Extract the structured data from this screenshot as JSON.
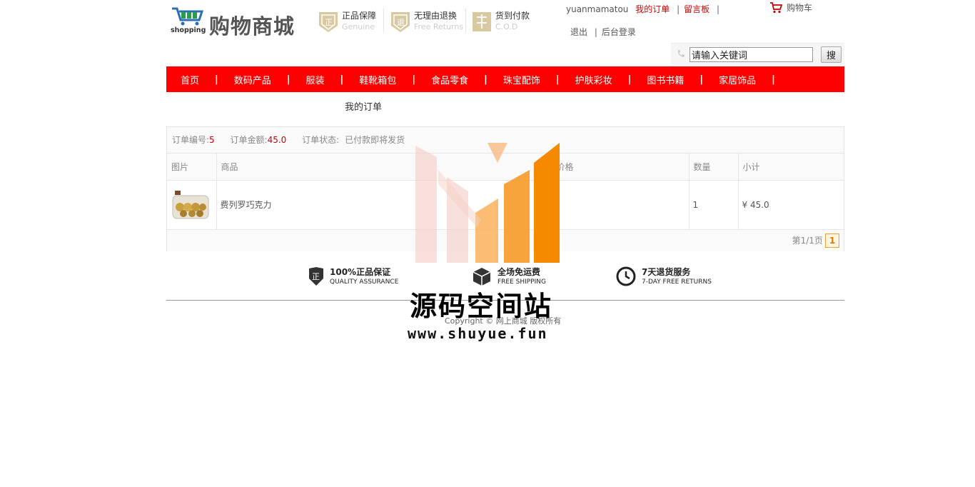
{
  "brand": {
    "title": "购物商城",
    "logo_text": "shopping"
  },
  "promises": [
    {
      "title": "正品保障",
      "subtitle": "Genuine"
    },
    {
      "title": "无理由退换",
      "subtitle": "Free Returns"
    },
    {
      "title": "货到付款",
      "subtitle": "C.O.D"
    }
  ],
  "toplinks": {
    "username": "yuanmamatou",
    "my_orders": "我的订单",
    "message_board": "留言板",
    "logout": "退出",
    "admin_login": "后台登录",
    "cart": "购物车"
  },
  "search": {
    "value": "请输入关键词",
    "button": "搜"
  },
  "nav": [
    "首页",
    "数码产品",
    "服装",
    "鞋靴箱包",
    "食品零食",
    "珠宝配饰",
    "护肤彩妆",
    "图书书籍",
    "家居饰品"
  ],
  "page_title": "我的订单",
  "order": {
    "number_label": "订单编号:",
    "number": "5",
    "amount_label": "订单金额:",
    "amount": "45.0",
    "status_label": "订单状态:",
    "status": "已付款即将发货"
  },
  "table": {
    "headers": [
      "图片",
      "商品",
      "价格",
      "数量",
      "小计"
    ],
    "rows": [
      {
        "name": "费列罗巧克力",
        "price": "",
        "qty": "1",
        "subtotal": "¥ 45.0"
      }
    ]
  },
  "pager": {
    "info": "第1/1页",
    "current": "1"
  },
  "assurances": [
    {
      "title": "100%正品保证",
      "subtitle": "QUALITY ASSURANCE"
    },
    {
      "title": "全场免运费",
      "subtitle": "FREE SHIPPING"
    },
    {
      "title": "7天退货服务",
      "subtitle": "7-DAY FREE RETURNS"
    }
  ],
  "copyright": "Copyright © 网上商城 版权所有",
  "watermark": {
    "title": "源码空间站",
    "url": "www.shuyue.fun"
  }
}
